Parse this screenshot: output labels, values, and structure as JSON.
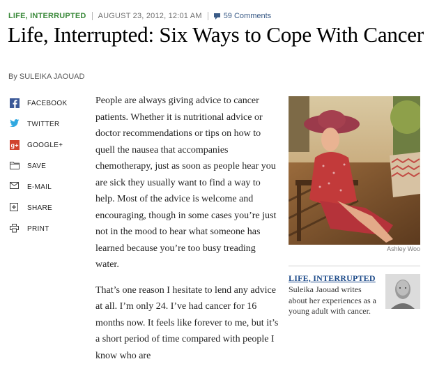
{
  "header": {
    "kicker": "LIFE, INTERRUPTED",
    "date": "AUGUST 23, 2012, 12:01 AM",
    "comments": "59 Comments",
    "comment_icon": "comment-bubble-icon"
  },
  "headline": "Life, Interrupted: Six Ways to Cope With Cancer",
  "byline": "By SULEIKA JAOUAD",
  "share_tools": [
    {
      "label": "FACEBOOK",
      "icon": "facebook-icon"
    },
    {
      "label": "TWITTER",
      "icon": "twitter-icon"
    },
    {
      "label": "GOOGLE+",
      "icon": "google-plus-icon"
    },
    {
      "label": "SAVE",
      "icon": "folder-icon"
    },
    {
      "label": "E-MAIL",
      "icon": "envelope-icon"
    },
    {
      "label": "SHARE",
      "icon": "plus-box-icon"
    },
    {
      "label": "PRINT",
      "icon": "printer-icon"
    }
  ],
  "body": {
    "p1": "People are always giving advice to cancer patients. Whether it is nutritional advice or doctor recommendations or tips on how to quell the nausea that accompanies chemotherapy, just as soon as people hear you are sick they usually want to find a way to help. Most of the advice is welcome and encouraging, though in some cases you’re just not in the mood to hear what someone has learned because you’re too busy treading water.",
    "p2": "That’s one reason I hesitate to lend any advice at all. I’m only 24. I’ve had cancer for 16 months now. It feels like forever to me, but it’s a short period of time compared with people I know who are"
  },
  "photo": {
    "credit": "Ashley Woo"
  },
  "promo": {
    "title": "LIFE, INTERRUPTED",
    "text": "Suleika Jaouad writes about her experiences as a young adult with cancer."
  },
  "colors": {
    "kicker": "#3b8a3b",
    "link": "#1f4c8a",
    "facebook": "#3b5998",
    "twitter": "#2fa8e0",
    "google": "#d0432e"
  }
}
